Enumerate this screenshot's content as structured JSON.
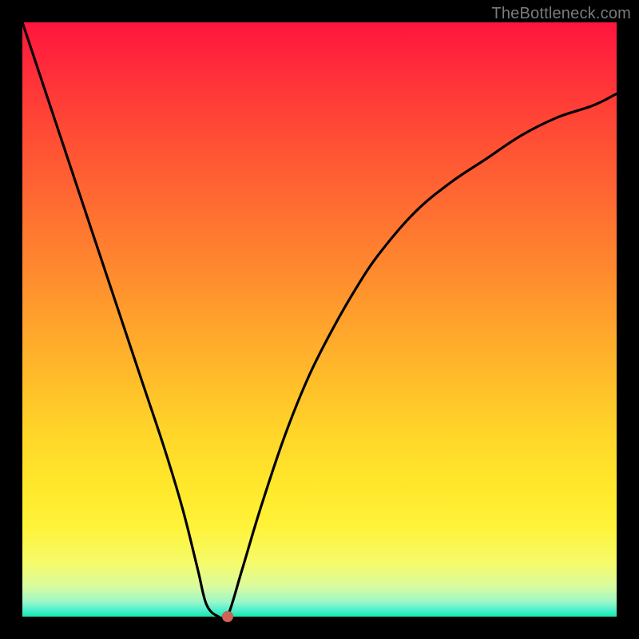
{
  "watermark": "TheBottleneck.com",
  "chart_data": {
    "type": "line",
    "title": "",
    "xlabel": "",
    "ylabel": "",
    "xlim": [
      0,
      100
    ],
    "ylim": [
      0,
      100
    ],
    "grid": false,
    "legend": false,
    "series": [
      {
        "name": "curve",
        "x": [
          0,
          4,
          8,
          12,
          16,
          20,
          24,
          27,
          29.5,
          31,
          33,
          34.5,
          37,
          40,
          44,
          48,
          52,
          56,
          60,
          66,
          72,
          78,
          84,
          90,
          96,
          100
        ],
        "y": [
          100,
          88,
          76,
          64,
          52,
          40,
          28,
          18,
          8,
          2,
          0,
          0,
          8,
          18,
          30,
          40,
          48,
          55,
          61,
          68,
          73,
          77,
          81,
          84,
          86,
          88
        ]
      }
    ],
    "marker": {
      "x": 34.5,
      "y": 0,
      "color": "#d06356"
    },
    "background_gradient": {
      "top": "#ff153e",
      "mid": "#ffd029",
      "bottom": "#19e6a8"
    }
  }
}
